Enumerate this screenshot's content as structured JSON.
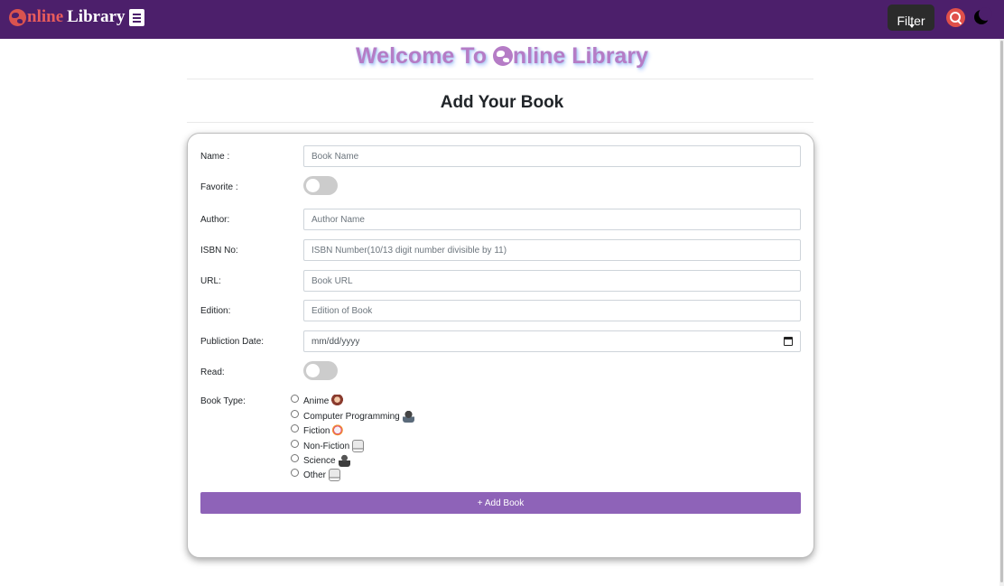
{
  "navbar": {
    "brand_online": "nline",
    "brand_library": "Library",
    "filter_label": "Filter"
  },
  "welcome": {
    "prefix": "Welcome To ",
    "suffix": "nline Library"
  },
  "form_title": "Add Your Book",
  "form": {
    "name": {
      "label": "Name :",
      "placeholder": "Book Name"
    },
    "favorite": {
      "label": "Favorite :",
      "checked": false
    },
    "author": {
      "label": "Author:",
      "placeholder": "Author Name"
    },
    "isbn": {
      "label": "ISBN No:",
      "placeholder": "ISBN Number(10/13 digit number divisible by 11)"
    },
    "url": {
      "label": "URL:",
      "placeholder": "Book URL"
    },
    "edition": {
      "label": "Edition:",
      "placeholder": "Edition of Book"
    },
    "publication_date": {
      "label": "Publiction Date:",
      "placeholder": "mm/dd/yyyy"
    },
    "read": {
      "label": "Read:",
      "checked": false
    },
    "book_type": {
      "label": "Book Type:",
      "options": [
        "Anime",
        "Computer Programming",
        "Fiction",
        "Non-Fiction",
        "Science",
        "Other"
      ],
      "selected": null
    },
    "submit_label": "+ Add Book"
  },
  "colors": {
    "navbar": "#4c1f6b",
    "brand_accent": "#e85c5c",
    "welcome_text": "#b57cc6",
    "submit_button": "#8e63b8",
    "toggle_off": "#cccccc"
  }
}
